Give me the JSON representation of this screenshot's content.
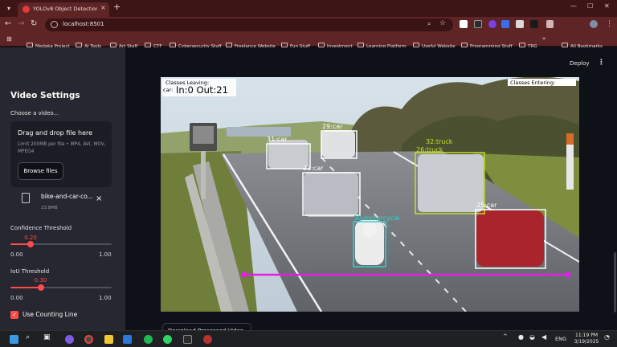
{
  "browser": {
    "tab_title": "YOLOv8 Object Detection & Co",
    "tab_close": "×",
    "new_tab": "+",
    "url": "localhost:8501",
    "bookmarks": [
      "Medaka Project",
      "AI Tools",
      "Art Stuff",
      "CTF",
      "Cybersecurity Stuff",
      "Freelance Website",
      "Fun Stuff",
      "Investment",
      "Learning Platform",
      "Useful Website",
      "Programming Stuff",
      "TRG",
      "All Bookmarks"
    ],
    "colors": {
      "frame": "#3d1516",
      "toolbar": "#5e2426"
    }
  },
  "sidebar": {
    "title": "Video Settings",
    "choose_label": "Choose a video...",
    "dropzone_title": "Drag and drop file here",
    "dropzone_limit": "Limit 200MB per file • MP4, AVI, MOV, MPEG4",
    "browse_label": "Browse files",
    "file_name": "bike-and-car-co...",
    "file_size": "23.8MB",
    "remove": "×",
    "confidence": {
      "label": "Confidence Threshold",
      "value": "0.20",
      "level": 0.2,
      "min": "0.00",
      "max": "1.00"
    },
    "iou": {
      "label": "IoU Threshold",
      "value": "0.30",
      "level": 0.3,
      "min": "0.00",
      "max": "1.00"
    },
    "counting_label": "Use Counting Line",
    "counting_checked": true
  },
  "main": {
    "deploy": "Deploy",
    "download_label": "Download Processed Video",
    "accent": "#ff4b4b",
    "video": {
      "classes_leaving_label": "Classes  Leaving:",
      "classes_leaving_value": "car:",
      "counter": "In:0  Out:21",
      "classes_entering_label": "Classes  Entering:",
      "detections": [
        {
          "label": "31:car"
        },
        {
          "label": "29:car"
        },
        {
          "label": "23:car"
        },
        {
          "label": "32:truck"
        },
        {
          "label": "26:truck"
        },
        {
          "label": "25:car"
        },
        {
          "label": "30:motorcycle"
        }
      ],
      "line_color": "#e11fe6"
    }
  },
  "taskbar": {
    "lang": "ENG",
    "time": "11:19 PM",
    "date": "3/19/2025"
  }
}
